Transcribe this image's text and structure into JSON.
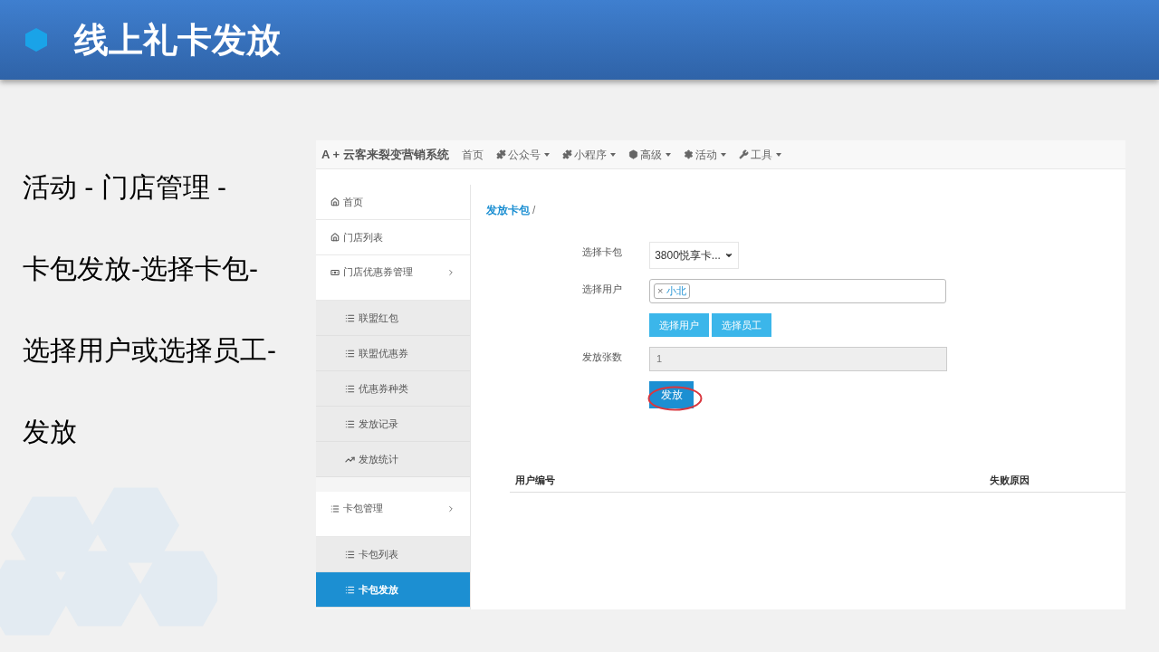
{
  "slide": {
    "title": "线上礼卡发放",
    "steps": [
      "活动 - 门店管理 -",
      "卡包发放-选择卡包-",
      "选择用户或选择员工-",
      "发放"
    ]
  },
  "app": {
    "brand": "A + 云客来裂变营销系统",
    "nav": [
      {
        "label": "首页",
        "dropdown": false
      },
      {
        "label": "公众号",
        "dropdown": true
      },
      {
        "label": "小程序",
        "dropdown": true
      },
      {
        "label": "高级",
        "dropdown": true
      },
      {
        "label": "活动",
        "dropdown": true
      },
      {
        "label": "工具",
        "dropdown": true
      }
    ],
    "sidebar": [
      {
        "label": "首页",
        "selected": false
      },
      {
        "label": "门店列表",
        "selected": false
      },
      {
        "label": "门店优惠券管理",
        "selected": false,
        "children": [
          {
            "label": "联盟红包",
            "selected": false
          },
          {
            "label": "联盟优惠券",
            "selected": false
          },
          {
            "label": "优惠券种类",
            "selected": false
          },
          {
            "label": "发放记录",
            "selected": false
          },
          {
            "label": "发放统计",
            "selected": false
          }
        ]
      },
      {
        "label": "卡包管理",
        "selected": false,
        "children": [
          {
            "label": "卡包列表",
            "selected": false
          },
          {
            "label": "卡包发放",
            "selected": true
          }
        ]
      }
    ],
    "breadcrumb": {
      "link": "发放卡包",
      "separator": "/"
    },
    "form": {
      "card_label": "选择卡包",
      "card_value": "3800悦享卡...",
      "user_label": "选择用户",
      "user_tags": [
        {
          "remove": "×",
          "label": "小北"
        }
      ],
      "pick_buttons": [
        "选择用户",
        "选择员工"
      ],
      "count_label": "发放张数",
      "count_value": "1",
      "submit": "发放",
      "submit_circled": true
    },
    "table": {
      "columns": [
        "用户编号",
        "失败原因"
      ]
    }
  }
}
